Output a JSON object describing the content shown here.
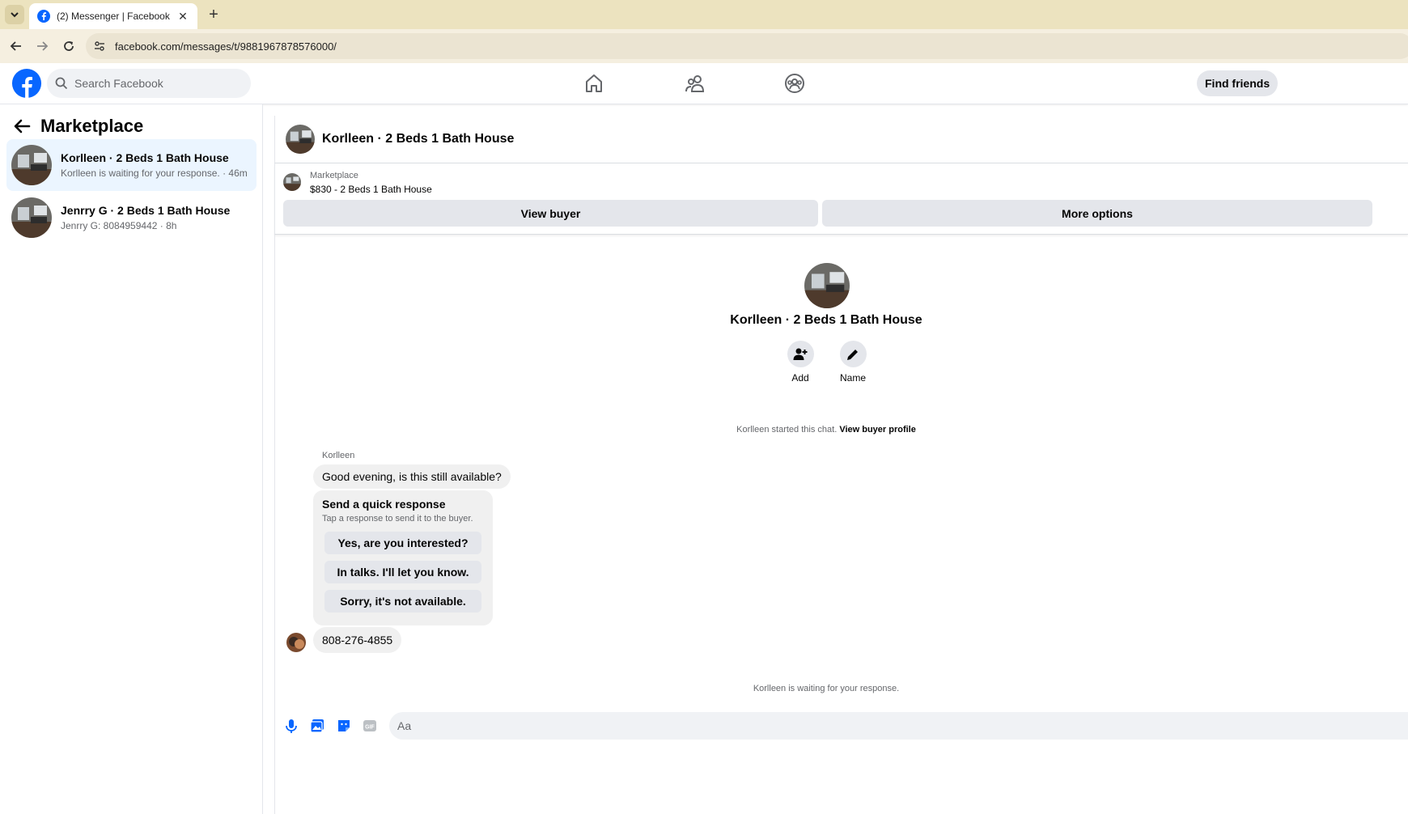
{
  "browser": {
    "tab_title": "(2) Messenger | Facebook",
    "url": "facebook.com/messages/t/9881967878576000/"
  },
  "header": {
    "search_placeholder": "Search Facebook",
    "find_friends": "Find friends"
  },
  "sidebar": {
    "title": "Marketplace",
    "conversations": [
      {
        "name": "Korlleen · 2 Beds 1 Bath House",
        "preview": "Korlleen is waiting for your response. · 46m",
        "active": true
      },
      {
        "name": "Jenrry G · 2 Beds 1 Bath House",
        "preview": "Jenrry G: 8084959442 · 8h",
        "active": false
      }
    ]
  },
  "chat": {
    "title": "Korlleen · 2 Beds 1 Bath House",
    "listing_label": "Marketplace",
    "listing_price": "$830 - 2 Beds 1 Bath House",
    "view_buyer": "View buyer",
    "more_options": "More options",
    "profile_name": "Korlleen · 2 Beds 1 Bath House",
    "add_label": "Add",
    "name_label": "Name",
    "started_text": "Korlleen started this chat.",
    "view_buyer_profile": "View buyer profile",
    "sender": "Korlleen",
    "message1": "Good evening, is this still available?",
    "quick_title": "Send a quick response",
    "quick_sub": "Tap a response to send it to the buyer.",
    "quick_replies": [
      "Yes, are you interested?",
      "In talks. I'll let you know.",
      "Sorry, it's not available."
    ],
    "message2": "808-276-4855",
    "waiting_text": "Korlleen is waiting for your response.",
    "composer_placeholder": "Aa"
  },
  "colors": {
    "facebook_blue": "#0866ff",
    "active_conversation": "#ebf5ff",
    "bubble": "#f0f0f0",
    "button_grey": "#e4e6eb"
  }
}
